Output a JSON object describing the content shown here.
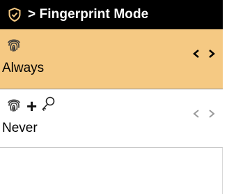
{
  "header": {
    "title": "> Fingerprint Mode",
    "icon": "shield-check-icon"
  },
  "options": [
    {
      "label": "Always",
      "selected": true,
      "icons": [
        "fingerprint-icon"
      ]
    },
    {
      "label": "Never",
      "selected": false,
      "icons": [
        "fingerprint-icon",
        "plus-icon",
        "key-icon"
      ]
    }
  ],
  "plus_symbol": "+",
  "colors": {
    "header_bg": "#000000",
    "selected_bg": "#f5c983",
    "arrow_active": "#000000",
    "arrow_inactive": "#9a9a9a"
  }
}
